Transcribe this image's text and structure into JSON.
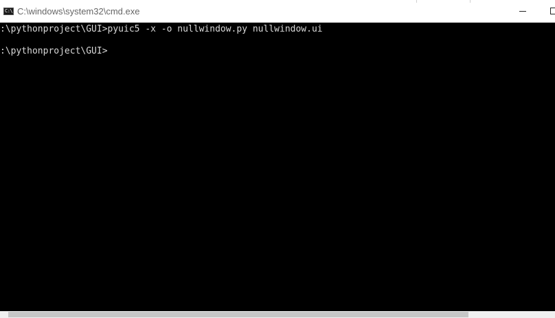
{
  "window": {
    "title": "C:\\windows\\system32\\cmd.exe",
    "icon": "console-app-icon",
    "icon_glyph": "C:\\"
  },
  "controls": {
    "minimize_icon": "minimize-icon",
    "maximize_icon": "maximize-icon"
  },
  "console": {
    "lines": [
      ":\\pythonproject\\GUI>pyuic5 -x -o nullwindow.py nullwindow.ui",
      ":\\pythonproject\\GUI>"
    ]
  },
  "colors": {
    "console_bg": "#000000",
    "console_text": "#d8d8d8",
    "titlebar_bg": "#ffffff",
    "title_text": "#666666",
    "scrollbar_track": "#f0f0f0",
    "scrollbar_thumb": "#c6c6c6"
  }
}
